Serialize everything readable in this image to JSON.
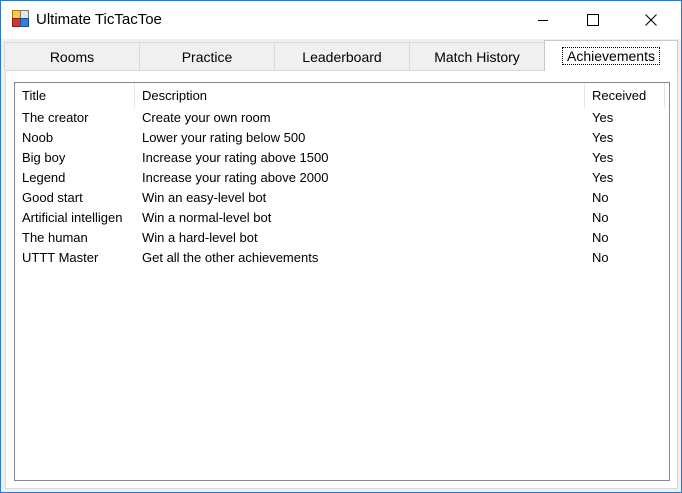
{
  "window": {
    "title": "Ultimate TicTacToe"
  },
  "tabs": [
    {
      "label": "Rooms"
    },
    {
      "label": "Practice"
    },
    {
      "label": "Leaderboard"
    },
    {
      "label": "Match History"
    },
    {
      "label": "Achievements"
    }
  ],
  "active_tab": "Achievements",
  "achievements": {
    "columns": [
      "Title",
      "Description",
      "Received"
    ],
    "rows": [
      [
        "The creator",
        "Create your own room",
        "Yes"
      ],
      [
        "Noob",
        "Lower your rating below 500",
        "Yes"
      ],
      [
        "Big boy",
        "Increase your rating above 1500",
        "Yes"
      ],
      [
        "Legend",
        "Increase your rating above 2000",
        "Yes"
      ],
      [
        "Good start",
        "Win an easy-level bot",
        "No"
      ],
      [
        "Artificial intelligen",
        "Win a normal-level bot",
        "No"
      ],
      [
        "The human",
        "Win a hard-level bot",
        "No"
      ],
      [
        "UTTT Master",
        "Get all the other achievements",
        "No"
      ]
    ]
  },
  "colors": {
    "window_border": "#2b79d3",
    "background": "#f0f0f0"
  },
  "icons": {
    "app": "app-icon",
    "minimize": "minimize-icon",
    "maximize": "maximize-icon",
    "close": "close-icon"
  }
}
